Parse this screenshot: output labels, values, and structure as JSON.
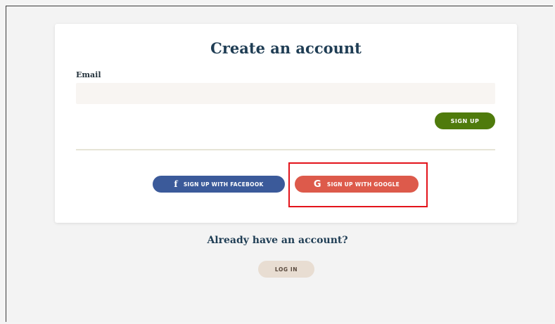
{
  "card": {
    "title": "Create an account",
    "email_label": "Email",
    "email_value": "",
    "email_placeholder": "",
    "signup_label": "SIGN UP"
  },
  "social": {
    "facebook_label": "SIGN UP WITH FACEBOOK",
    "facebook_icon": "f",
    "google_label": "SIGN UP WITH GOOGLE",
    "google_icon": "G"
  },
  "footer": {
    "already_text": "Already have an account?",
    "login_label": "LOG IN"
  },
  "colors": {
    "title": "#1f3d54",
    "signup": "#4f7b0c",
    "facebook": "#3b5a9a",
    "google": "#dd5a4b",
    "highlight": "#e3131b",
    "login": "#e8ddd2"
  }
}
